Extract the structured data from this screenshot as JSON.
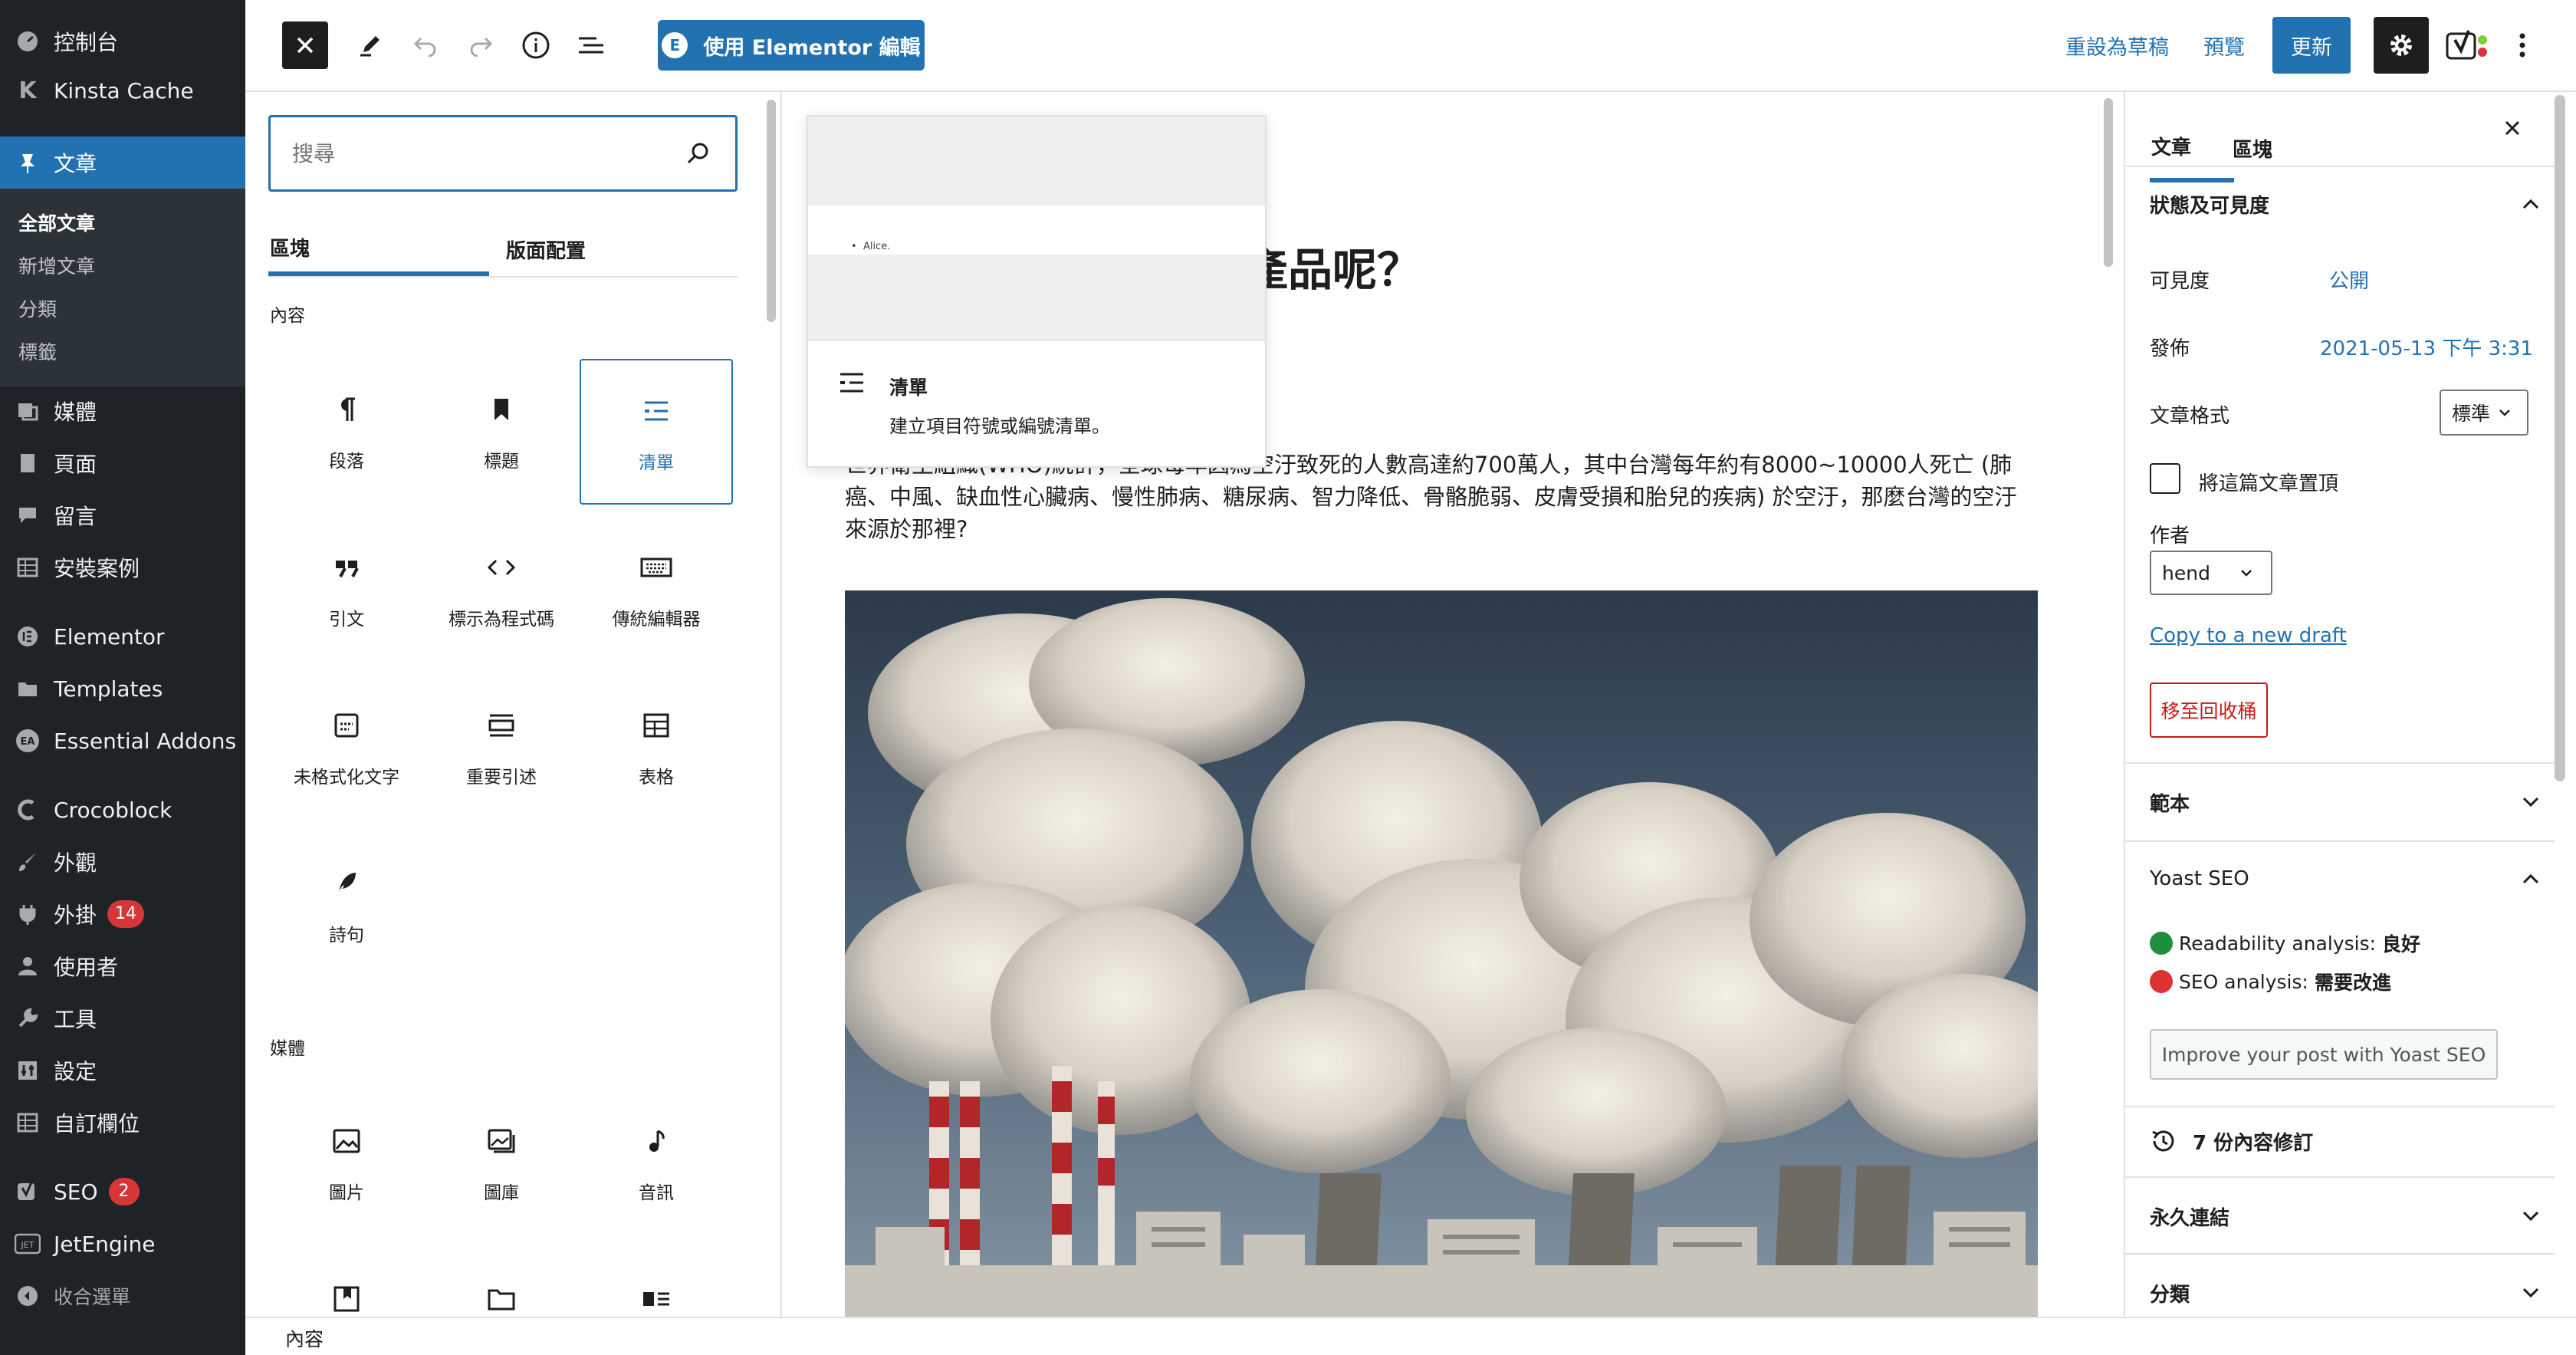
{
  "admin_menu": {
    "items": [
      {
        "label": "控制台",
        "icon": "dashboard-icon"
      },
      {
        "label": "Kinsta Cache",
        "icon": "kinsta-icon"
      },
      {
        "label": "文章",
        "icon": "pin-icon",
        "active": true
      },
      {
        "label": "媒體",
        "icon": "media-icon"
      },
      {
        "label": "頁面",
        "icon": "page-icon"
      },
      {
        "label": "留言",
        "icon": "comment-icon"
      },
      {
        "label": "安裝案例",
        "icon": "table-icon"
      },
      {
        "label": "Elementor",
        "icon": "elementor-icon"
      },
      {
        "label": "Templates",
        "icon": "folder-icon"
      },
      {
        "label": "Essential Addons",
        "icon": "ea-icon"
      },
      {
        "label": "Crocoblock",
        "icon": "crocoblock-icon"
      },
      {
        "label": "外觀",
        "icon": "brush-icon"
      },
      {
        "label": "外掛",
        "icon": "plugin-icon",
        "badge": "14"
      },
      {
        "label": "使用者",
        "icon": "user-icon"
      },
      {
        "label": "工具",
        "icon": "wrench-icon"
      },
      {
        "label": "設定",
        "icon": "settings-icon"
      },
      {
        "label": "自訂欄位",
        "icon": "table-icon"
      },
      {
        "label": "SEO",
        "icon": "yoast-icon",
        "badge": "2"
      },
      {
        "label": "JetEngine",
        "icon": "jet-icon"
      },
      {
        "label": "收合選單",
        "icon": "collapse-icon"
      }
    ],
    "submenu": [
      "全部文章",
      "新增文章",
      "分類",
      "標籤"
    ]
  },
  "toolbar": {
    "elementor_label": "使用 Elementor 編輯",
    "save_draft_label": "重設為草稿",
    "preview_label": "預覽",
    "update_label": "更新"
  },
  "inserter": {
    "search_placeholder": "搜尋",
    "tabs": [
      "區塊",
      "版面配置"
    ],
    "categories": {
      "content": "內容",
      "media": "媒體"
    },
    "content_blocks": [
      {
        "label": "段落",
        "icon": "paragraph-icon"
      },
      {
        "label": "標題",
        "icon": "heading-icon"
      },
      {
        "label": "清單",
        "icon": "list-icon",
        "highlighted": true
      },
      {
        "label": "引文",
        "icon": "quote-icon"
      },
      {
        "label": "標示為程式碼",
        "icon": "code-icon"
      },
      {
        "label": "傳統編輯器",
        "icon": "keyboard-icon"
      },
      {
        "label": "未格式化文字",
        "icon": "preformatted-icon"
      },
      {
        "label": "重要引述",
        "icon": "pullquote-icon"
      },
      {
        "label": "表格",
        "icon": "table-icon"
      },
      {
        "label": "詩句",
        "icon": "verse-icon"
      }
    ],
    "media_blocks": [
      {
        "label": "圖片",
        "icon": "image-icon"
      },
      {
        "label": "圖庫",
        "icon": "gallery-icon"
      },
      {
        "label": "音訊",
        "icon": "audio-icon"
      }
    ]
  },
  "preview": {
    "sample_item": "Alice.",
    "title": "清單",
    "description": "建立項目符號或編號清單。"
  },
  "post": {
    "title_fragment": "產品呢？",
    "paragraph": "世界衛生組織(WHO)統計，全球每年因為空汙致死的人數高達約700萬人，其中台灣每年約有8000~10000人死亡 (肺癌、中風、缺血性心臟病、慢性肺病、糖尿病、智力降低、骨骼脆弱、皮膚受損和胎兒的疾病) 於空汙，那麼台灣的空汙來源於那裡?"
  },
  "settings": {
    "tabs": [
      "文章",
      "區塊"
    ],
    "status_panel": {
      "title": "狀態及可見度",
      "visibility_label": "可見度",
      "visibility_value": "公開",
      "publish_label": "發佈",
      "publish_value": "2021-05-13 下午 3:31",
      "format_label": "文章格式",
      "format_value": "標準",
      "sticky_label": "將這篇文章置頂",
      "author_label": "作者",
      "author_value": "hend",
      "copy_draft_link": "Copy to a new draft",
      "trash_label": "移至回收桶"
    },
    "template_panel": "範本",
    "yoast_panel": {
      "title": "Yoast SEO",
      "readability_label": "Readability analysis:",
      "readability_value": "良好",
      "seo_label": "SEO analysis:",
      "seo_value": "需要改進",
      "improve_button": "Improve your post with Yoast SEO"
    },
    "revisions": "7 份內容修訂",
    "permalink_panel": "永久連結",
    "categories_panel": "分類"
  },
  "footer": {
    "breadcrumb": "內容"
  },
  "colors": {
    "accent": "#2271b1",
    "admin_bg": "#1d2327",
    "good": "#1e8e3e",
    "bad": "#dc3232"
  }
}
